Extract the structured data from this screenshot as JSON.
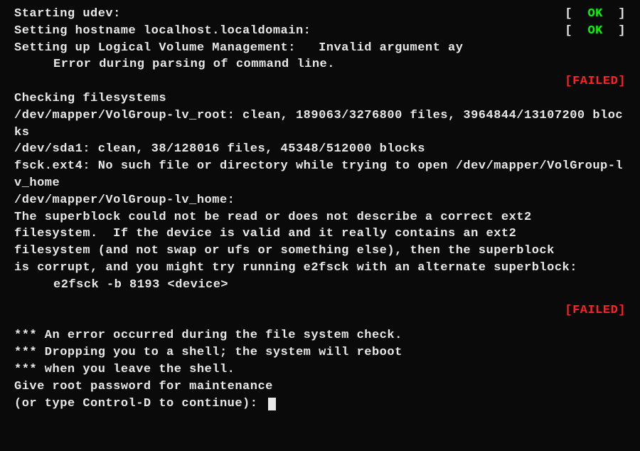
{
  "lines": {
    "l0": "Starting udev:",
    "l1": "Setting hostname localhost.localdomain:",
    "l2a": "Setting up Logical Volume Management:   Invalid argument ay",
    "l2b": "Error during parsing of command line.",
    "l3": "Checking filesystems",
    "l4": "/dev/mapper/VolGroup-lv_root: clean, 189063/3276800 files, 3964844/13107200 blocks",
    "l5": "/dev/sda1: clean, 38/128016 files, 45348/512000 blocks",
    "l6": "fsck.ext4: No such file or directory while trying to open /dev/mapper/VolGroup-lv_home",
    "l7": "/dev/mapper/VolGroup-lv_home:",
    "l8": "The superblock could not be read or does not describe a correct ext2",
    "l9": "filesystem.  If the device is valid and it really contains an ext2",
    "l10": "filesystem (and not swap or ufs or something else), then the superblock",
    "l11": "is corrupt, and you might try running e2fsck with an alternate superblock:",
    "l12": "e2fsck -b 8193 <device>",
    "l13": "*** An error occurred during the file system check.",
    "l14": "*** Dropping you to a shell; the system will reboot",
    "l15": "*** when you leave the shell.",
    "l16": "Give root password for maintenance",
    "l17": "(or type Control-D to continue): "
  },
  "status": {
    "ok": "OK",
    "failed": "FAILED",
    "lb": "[  ",
    "rb": "  ]",
    "lb2": "[",
    "rb2": "]"
  }
}
